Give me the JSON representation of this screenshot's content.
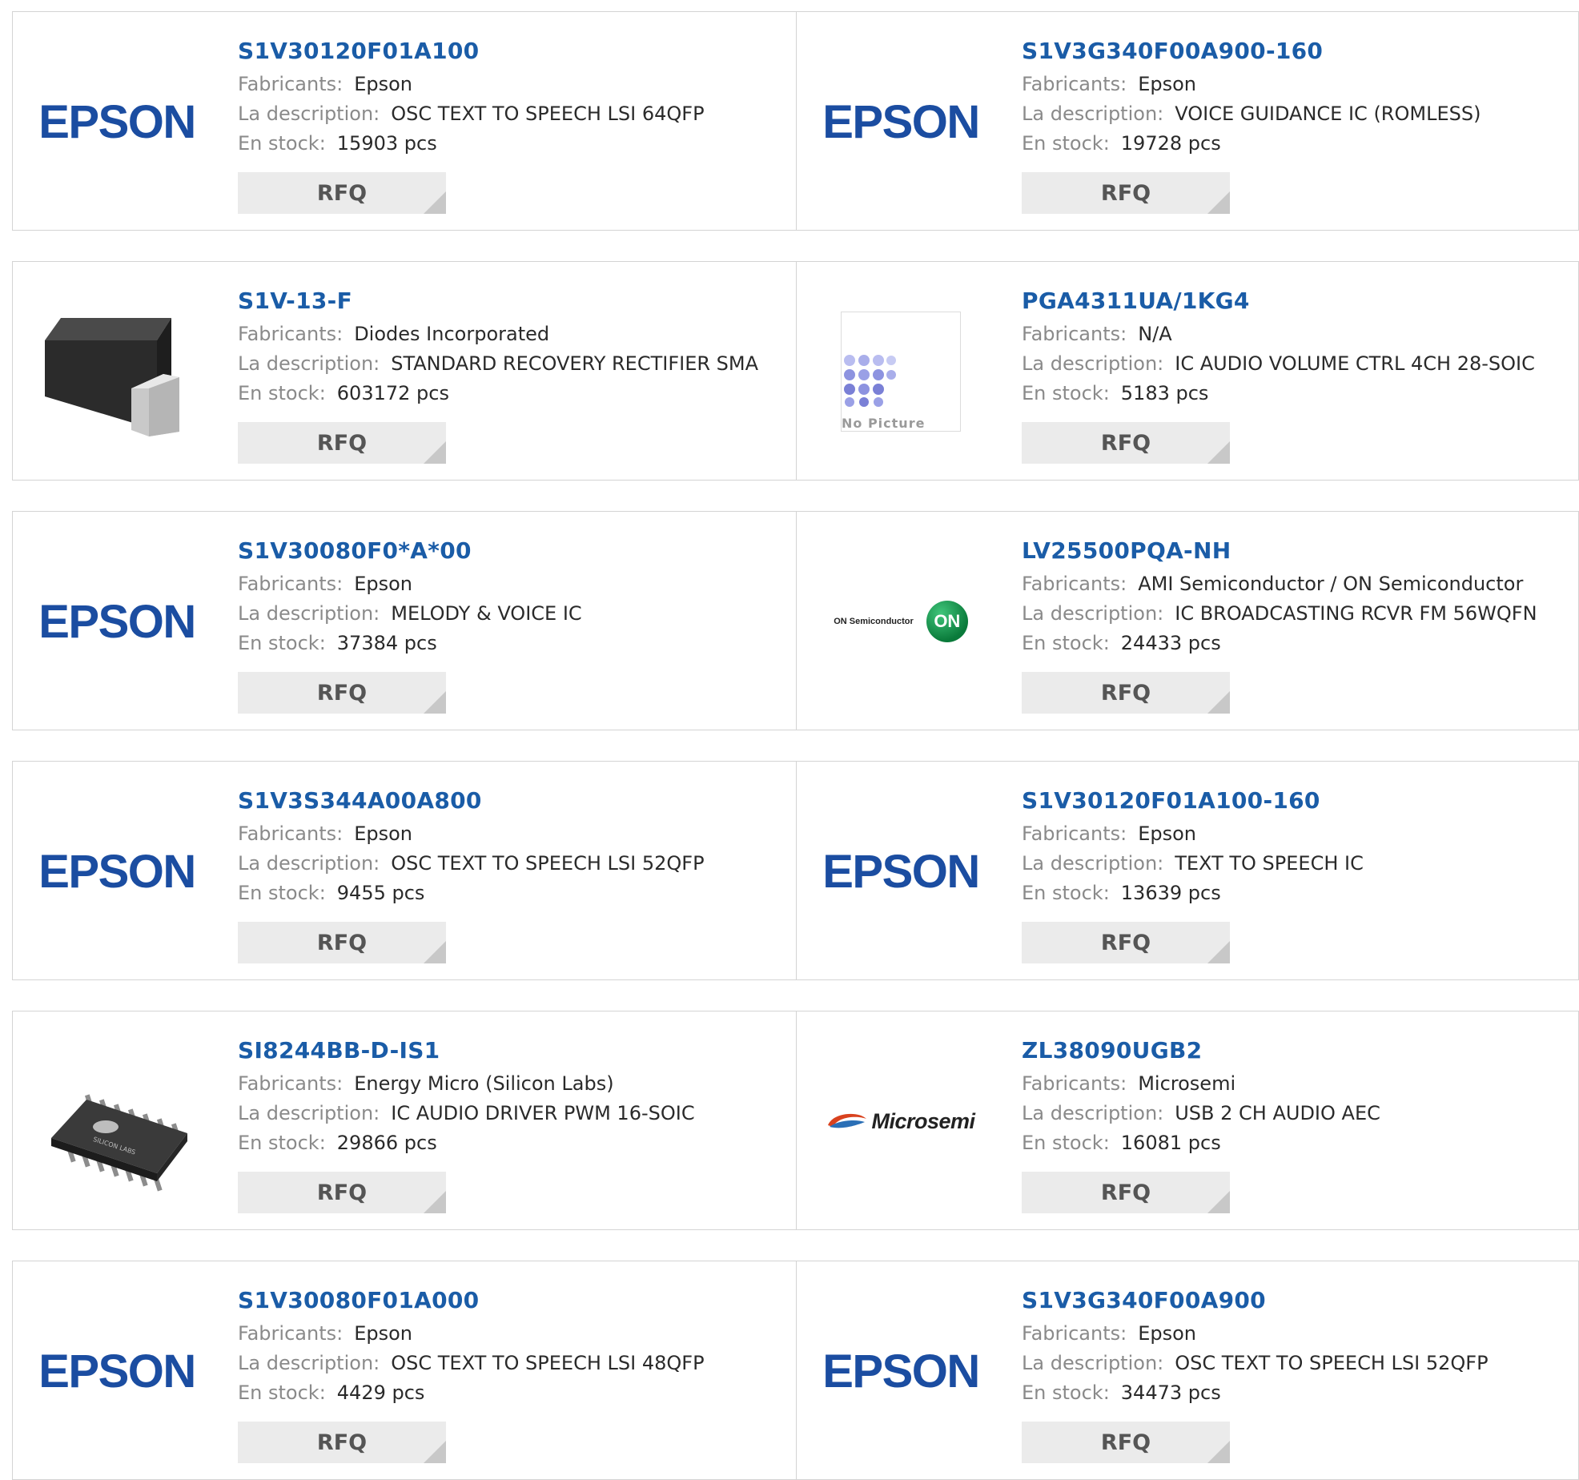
{
  "labels": {
    "manufacturer": "Fabricants:",
    "description": "La description:",
    "stock": "En stock:",
    "rfq": "RFQ"
  },
  "logos": {
    "epson": "EPSON",
    "on_semi_text": "ON Semiconductor",
    "on_semi_mark": "ON",
    "microsemi": "Microsemi",
    "no_picture": "No Picture",
    "silicon_labs": "SILICON LABS"
  },
  "colors": {
    "part_link": "#1a5ca7",
    "label_gray": "#8a8a8a",
    "rfq_bg": "#ebebeb",
    "border": "#d4d4d4",
    "epson_blue": "#1b4da1"
  },
  "products": [
    {
      "part": "S1V30120F01A100",
      "manufacturer": "Epson",
      "description": "OSC TEXT TO SPEECH LSI 64QFP",
      "stock": "15903 pcs",
      "image": "epson-logo"
    },
    {
      "part": "S1V3G340F00A900-160",
      "manufacturer": "Epson",
      "description": "VOICE GUIDANCE IC (ROMLESS)",
      "stock": "19728 pcs",
      "image": "epson-logo"
    },
    {
      "part": "S1V-13-F",
      "manufacturer": "Diodes Incorporated",
      "description": "STANDARD RECOVERY RECTIFIER SMA",
      "stock": "603172 pcs",
      "image": "sma-package"
    },
    {
      "part": "PGA4311UA/1KG4",
      "manufacturer": "N/A",
      "description": "IC AUDIO VOLUME CTRL 4CH 28-SOIC",
      "stock": "5183 pcs",
      "image": "no-picture"
    },
    {
      "part": "S1V30080F0*A*00",
      "manufacturer": "Epson",
      "description": "MELODY & VOICE IC",
      "stock": "37384 pcs",
      "image": "epson-logo"
    },
    {
      "part": "LV25500PQA-NH",
      "manufacturer": "AMI Semiconductor / ON Semiconductor",
      "description": "IC BROADCASTING RCVR FM 56WQFN",
      "stock": "24433 pcs",
      "image": "onsemi-logo"
    },
    {
      "part": "S1V3S344A00A800",
      "manufacturer": "Epson",
      "description": "OSC TEXT TO SPEECH LSI 52QFP",
      "stock": "9455 pcs",
      "image": "epson-logo"
    },
    {
      "part": "S1V30120F01A100-160",
      "manufacturer": "Epson",
      "description": "TEXT TO SPEECH IC",
      "stock": "13639 pcs",
      "image": "epson-logo"
    },
    {
      "part": "SI8244BB-D-IS1",
      "manufacturer": "Energy Micro (Silicon Labs)",
      "description": "IC AUDIO DRIVER PWM 16-SOIC",
      "stock": "29866 pcs",
      "image": "soic-chip"
    },
    {
      "part": "ZL38090UGB2",
      "manufacturer": "Microsemi",
      "description": "USB 2 CH AUDIO AEC",
      "stock": "16081 pcs",
      "image": "microsemi-logo"
    },
    {
      "part": "S1V30080F01A000",
      "manufacturer": "Epson",
      "description": "OSC TEXT TO SPEECH LSI 48QFP",
      "stock": "4429 pcs",
      "image": "epson-logo"
    },
    {
      "part": "S1V3G340F00A900",
      "manufacturer": "Epson",
      "description": "OSC TEXT TO SPEECH LSI 52QFP",
      "stock": "34473 pcs",
      "image": "epson-logo"
    }
  ]
}
